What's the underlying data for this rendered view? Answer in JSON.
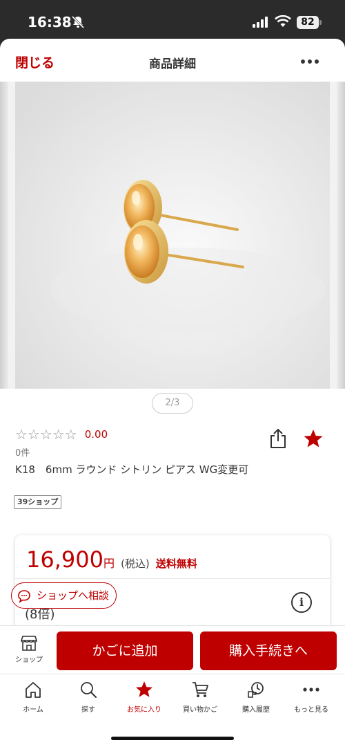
{
  "status_bar": {
    "time": "16:38",
    "battery": "82"
  },
  "header": {
    "close_label": "閉じる",
    "title": "商品詳細"
  },
  "gallery": {
    "indicator": "2/3"
  },
  "product": {
    "stars": "☆☆☆☆☆",
    "rating": "0.00",
    "review_count": "0件",
    "title": "K18　6mm ラウンド シトリン ピアス WG変更可",
    "shop_badge": "39ショップ"
  },
  "price": {
    "amount": "16,900",
    "unit": "円",
    "tax": "(税込)",
    "shipping": "送料無料",
    "points": "(8倍)"
  },
  "consult": {
    "label": "ショップへ相談"
  },
  "actions": {
    "shop_label": "ショップ",
    "add_cart": "かごに追加",
    "checkout": "購入手続きへ"
  },
  "tabs": [
    {
      "label": "ホーム",
      "icon": "home-icon"
    },
    {
      "label": "探す",
      "icon": "search-icon"
    },
    {
      "label": "お気に入り",
      "icon": "star-icon"
    },
    {
      "label": "買い物かご",
      "icon": "cart-icon"
    },
    {
      "label": "購入履歴",
      "icon": "history-icon"
    },
    {
      "label": "もっと見る",
      "icon": "more-icon"
    }
  ],
  "colors": {
    "brand": "#bf0000",
    "text": "#333333",
    "status_bar": "#2b2b2b"
  }
}
